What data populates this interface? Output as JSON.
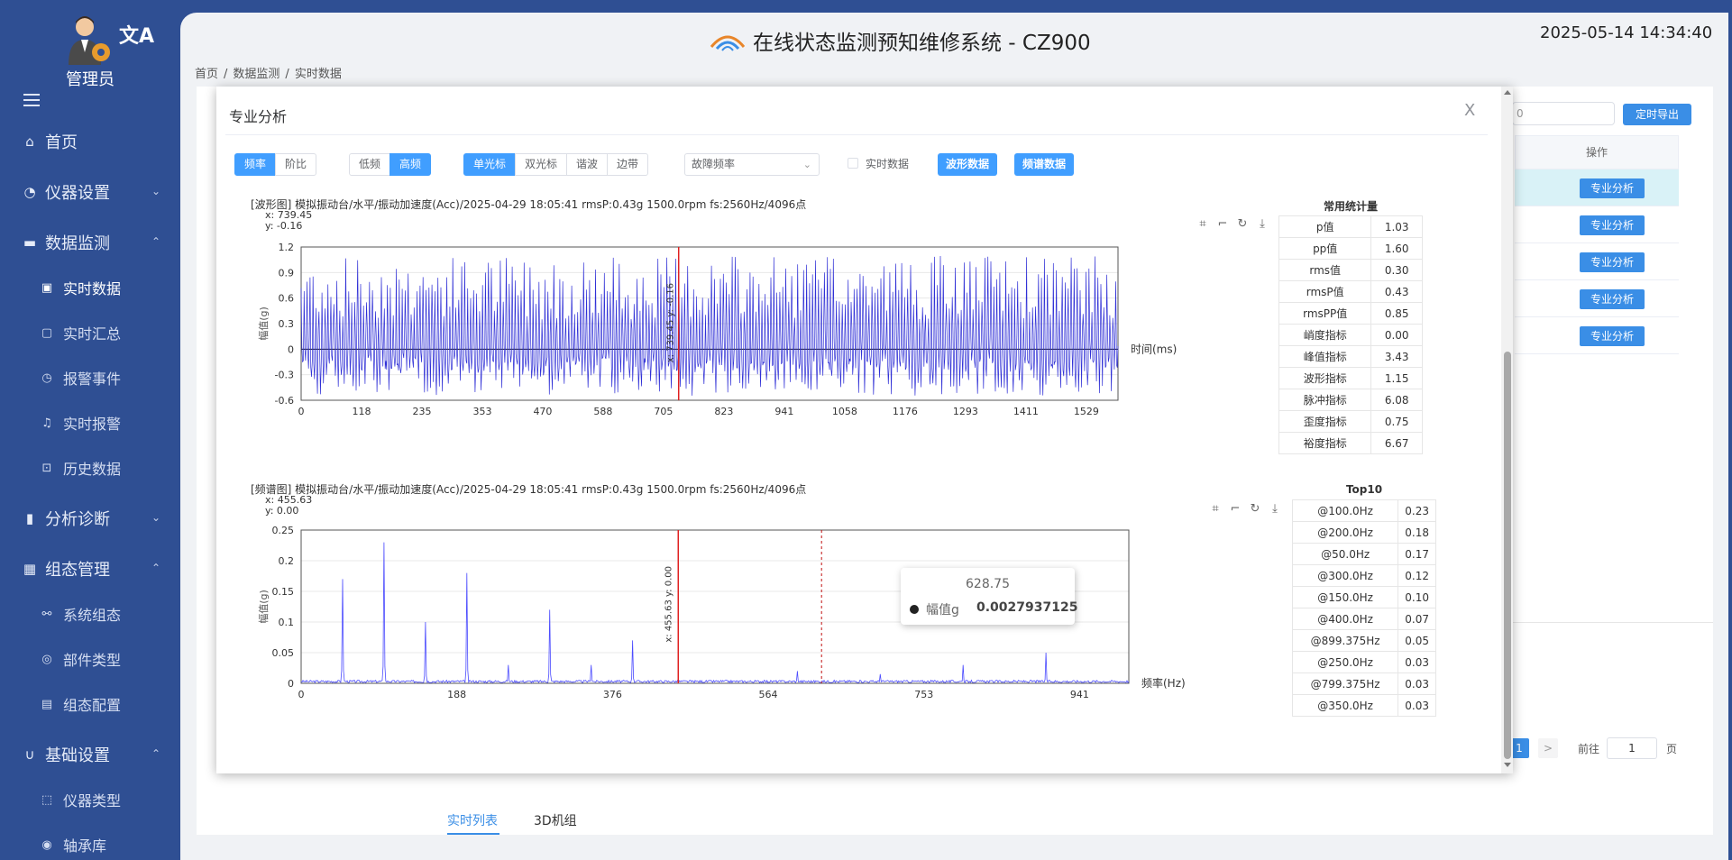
{
  "user": {
    "name": "管理员",
    "translate_icon": "translate-icon"
  },
  "sidebar": {
    "home": "首页",
    "instrument_settings": "仪器设置",
    "data_monitoring": "数据监测",
    "realtime_data": "实时数据",
    "realtime_summary": "实时汇总",
    "alarm_events": "报警事件",
    "realtime_alarm": "实时报警",
    "history_data": "历史数据",
    "analysis_diagnosis": "分析诊断",
    "group_management": "组态管理",
    "system_group": "系统组态",
    "component_type": "部件类型",
    "group_config": "组态配置",
    "basic_settings": "基础设置",
    "instrument_type": "仪器类型",
    "bearing_lib": "轴承库"
  },
  "header": {
    "title": "在线状态监测预知维修系统 - CZ900",
    "datetime": "2025-05-14 14:34:40"
  },
  "breadcrumb": [
    "首页",
    "/",
    "数据监测",
    "/",
    "实时数据"
  ],
  "background": {
    "export_label": "定时导出",
    "input_value": "0",
    "ops_header": "操作",
    "row_button": "专业分析",
    "page_number": "1",
    "page_next": ">",
    "goto_label": "前往",
    "goto_value": "1",
    "page_suffix": "页",
    "tab_list": "实时列表",
    "tab_3d": "3D机组"
  },
  "modal": {
    "title": "专业分析",
    "close": "X",
    "seg1": [
      "频率",
      "阶比"
    ],
    "seg2": [
      "低频",
      "高频"
    ],
    "seg3": [
      "单光标",
      "双光标",
      "谐波",
      "边带"
    ],
    "select_value": "故障频率",
    "checkbox_label": "实时数据",
    "waveform_btn": "波形数据",
    "spectrum_btn": "频谱数据"
  },
  "waveform": {
    "title": "[波形图]  模拟振动台/水平/振动加速度(Acc)/2025-04-29 18:05:41 rmsP:0.43g 1500.0rpm fs:2560Hz/4096点",
    "readout_x": "x:  739.45",
    "readout_y": "y:  -0.16",
    "cursor_label": "x: 739.45  y: -0.16",
    "stats_title": "常用统计量",
    "stats": [
      [
        "p值",
        "1.03"
      ],
      [
        "pp值",
        "1.60"
      ],
      [
        "rms值",
        "0.30"
      ],
      [
        "rmsP值",
        "0.43"
      ],
      [
        "rmsPP值",
        "0.85"
      ],
      [
        "峭度指标",
        "0.00"
      ],
      [
        "峰值指标",
        "3.43"
      ],
      [
        "波形指标",
        "1.15"
      ],
      [
        "脉冲指标",
        "6.08"
      ],
      [
        "歪度指标",
        "0.75"
      ],
      [
        "裕度指标",
        "6.67"
      ]
    ]
  },
  "spectrum": {
    "title": "[频谱图]  模拟振动台/水平/振动加速度(Acc)/2025-04-29 18:05:41 rmsP:0.43g 1500.0rpm fs:2560Hz/4096点",
    "readout_x": "x:  455.63",
    "readout_y": "y:  0.00",
    "cursor_label": "x: 455.63  y: 0.00",
    "top_title": "Top10",
    "top": [
      [
        "@100.0Hz",
        "0.23"
      ],
      [
        "@200.0Hz",
        "0.18"
      ],
      [
        "@50.0Hz",
        "0.17"
      ],
      [
        "@300.0Hz",
        "0.12"
      ],
      [
        "@150.0Hz",
        "0.10"
      ],
      [
        "@400.0Hz",
        "0.07"
      ],
      [
        "@899.375Hz",
        "0.05"
      ],
      [
        "@250.0Hz",
        "0.03"
      ],
      [
        "@799.375Hz",
        "0.03"
      ],
      [
        "@350.0Hz",
        "0.03"
      ]
    ],
    "tooltip": {
      "x": "628.75",
      "series": "幅值g",
      "value": "0.0027937125"
    }
  },
  "chart_data": [
    {
      "type": "line",
      "ylabel": "幅值(g)",
      "xlabel": "时间(ms)",
      "x_ticks": [
        "0",
        "118",
        "235",
        "353",
        "470",
        "588",
        "705",
        "823",
        "941",
        "1058",
        "1176",
        "1293",
        "1411",
        "1529"
      ],
      "y_ticks": [
        "1.2",
        "0.9",
        "0.6",
        "0.3",
        "0",
        "-0.3",
        "-0.6"
      ],
      "xlim": [
        0,
        1600
      ],
      "ylim": [
        -0.6,
        1.2
      ],
      "cursor_x": 739.45,
      "color": "#2f2fd6",
      "series": [
        {
          "values": []
        }
      ]
    },
    {
      "type": "line",
      "ylabel": "幅值(g)",
      "xlabel": "频率(Hz)",
      "x_ticks": [
        "0",
        "188",
        "376",
        "564",
        "753",
        "941"
      ],
      "y_ticks": [
        "0.25",
        "0.2",
        "0.15",
        "0.1",
        "0.05",
        "0"
      ],
      "xlim": [
        0,
        1000
      ],
      "ylim": [
        0,
        0.25
      ],
      "cursor_x": 455.63,
      "hover_x": 628.75,
      "color": "#4b4bff",
      "peaks": [
        [
          50,
          0.17
        ],
        [
          100,
          0.23
        ],
        [
          150,
          0.1
        ],
        [
          200,
          0.18
        ],
        [
          250,
          0.03
        ],
        [
          300,
          0.12
        ],
        [
          350,
          0.03
        ],
        [
          400,
          0.07
        ],
        [
          600,
          0.02
        ],
        [
          700,
          0.015
        ],
        [
          799.375,
          0.03
        ],
        [
          899.375,
          0.05
        ]
      ]
    }
  ]
}
